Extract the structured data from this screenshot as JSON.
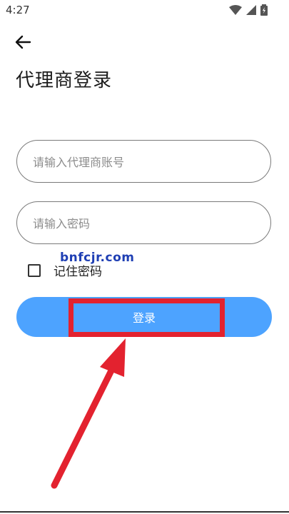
{
  "status_bar": {
    "time": "4:27"
  },
  "page": {
    "title": "代理商登录"
  },
  "form": {
    "account_placeholder": "请输入代理商账号",
    "password_placeholder": "请输入密码",
    "remember_label": "记住密码",
    "remember_checked": false,
    "login_label": "登录"
  },
  "watermark": "bnfcjr.com",
  "colors": {
    "button": "#4da3ff",
    "annotation": "#e3222f"
  }
}
